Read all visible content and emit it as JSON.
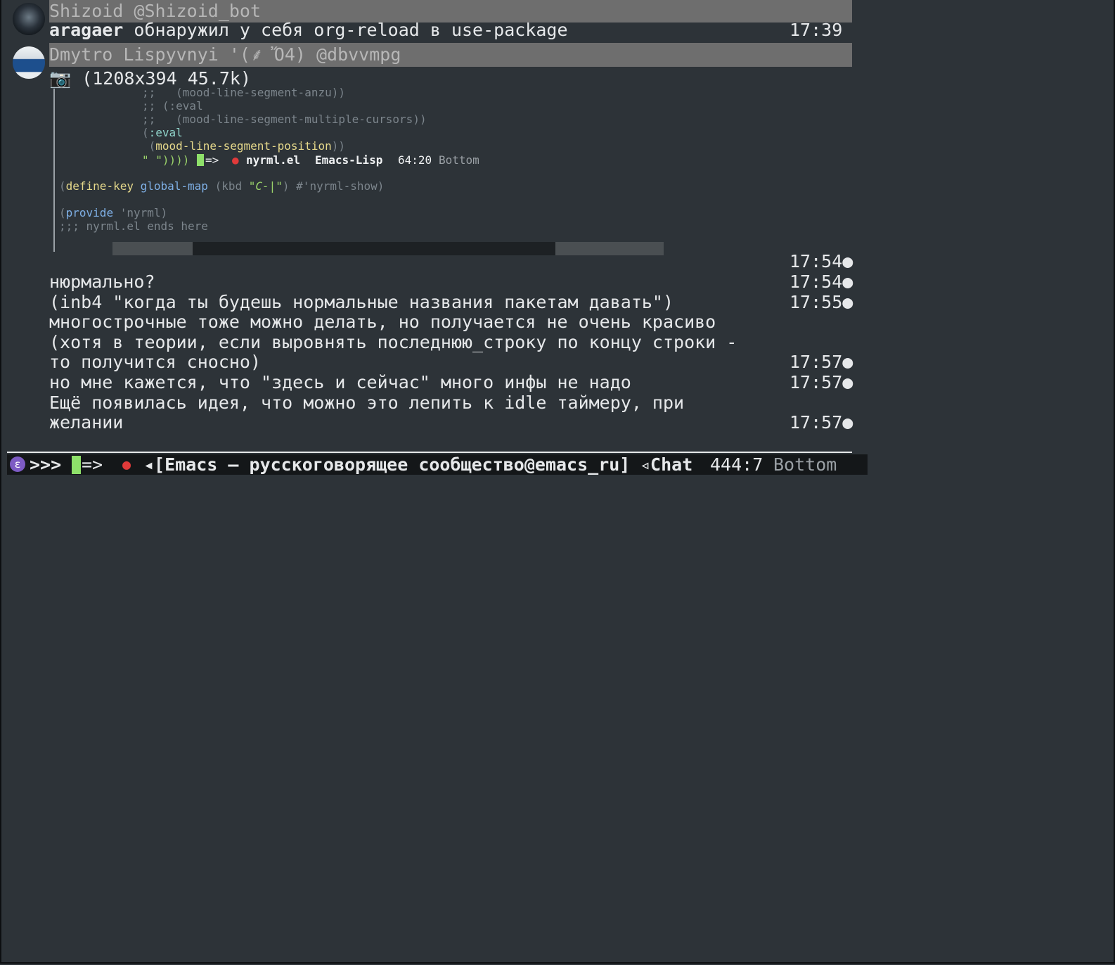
{
  "messages": [
    {
      "sender_header": "Shizoid @Shizoid_bot",
      "avatar": "shizoid-avatar",
      "author": "aragaer",
      "text": " обнаружил у себя org-reload в use-package",
      "time": "17:39"
    },
    {
      "sender_header": "Dmytro Lispyvnyi '(⸙ Ὄ4) @dbvvmpg",
      "avatar": "coding-drunk-avatar",
      "photo_icon": "📷",
      "photo_info": " (1208x394 45.7k)"
    }
  ],
  "code_image": {
    "lines": [
      {
        "parts": [
          {
            "t": ";;   (mood-line-segment-anzu))",
            "c": "comment"
          }
        ]
      },
      {
        "parts": [
          {
            "t": ";; (:eval",
            "c": "comment"
          }
        ]
      },
      {
        "parts": [
          {
            "t": ";;   (mood-line-segment-multiple-cursors))",
            "c": "comment"
          }
        ]
      },
      {
        "parts": [
          {
            "t": "(",
            "c": "comment"
          },
          {
            "t": ":eval",
            "c": "teal"
          }
        ]
      },
      {
        "parts": [
          {
            "t": " (",
            "c": "comment"
          },
          {
            "t": "mood-line-segment-position",
            "c": "yellow"
          },
          {
            "t": "))",
            "c": "comment"
          }
        ]
      }
    ],
    "modeline": {
      "lead": "\" \"))))",
      "arrow": "=>",
      "dot": "●",
      "file": "nyrml.el",
      "mode": "Emacs-Lisp",
      "pos": "64:20",
      "where": "Bottom"
    },
    "after_lines": {
      "define_key": {
        "open": "(",
        "fn": "define-key",
        "map": "global-map",
        "kbd_open": " (kbd ",
        "key": "\"C-|\"",
        "rest": ") #'nyrml-show)"
      },
      "provide": {
        "open": "(",
        "kw": "provide",
        "rest": " 'nyrml)"
      },
      "ends": ";;; nyrml.el ends here"
    }
  },
  "chat_lines": [
    {
      "text": "",
      "time": "17:54●"
    },
    {
      "text": "нюрмально?",
      "time": "17:54●"
    },
    {
      "text": "(inb4 \"когда ты будешь нормальные названия пакетам давать\")",
      "time": "17:55●"
    },
    {
      "text": "многострочные тоже можно делать, но получается не очень красиво",
      "time": ""
    },
    {
      "text": "(хотя в теории, если выровнять последнюю_строку по концу строки -",
      "time": ""
    },
    {
      "text": "то получится сносно)",
      "time": "17:57●"
    },
    {
      "text": "но мне кажется, что \"здесь и сейчас\" много инфы не надо",
      "time": "17:57●"
    },
    {
      "text": "Ещё появилась идея, что можно это лепить к idle таймеру, при",
      "time": ""
    },
    {
      "text": "желании",
      "time": "17:57●"
    }
  ],
  "modeline": {
    "icon": "ε",
    "prompt": ">>>",
    "arrow": "=>",
    "dot": "●",
    "buffer": "◂[Emacs — русскоговорящее сообщество@emacs_ru]",
    "mode": "◃Chat",
    "pos": "444:7",
    "where": "Bottom"
  },
  "colors": {
    "background": "#2d3338",
    "header_bar": "#6e6e6e",
    "modeline_bg": "#141719",
    "cursor": "#8ee06a",
    "dot": "#e03a3a"
  }
}
